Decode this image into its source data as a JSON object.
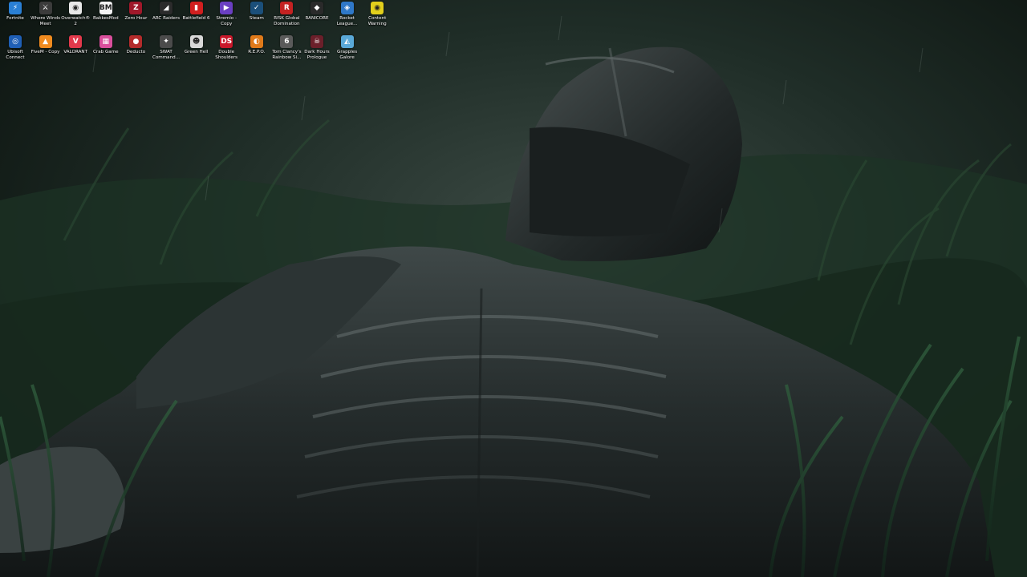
{
  "desktop": {
    "icons": [
      {
        "label": "Fortnite",
        "icon": "fortnite-icon",
        "glyph": "⚡",
        "color": "#2a7fd4"
      },
      {
        "label": "Where Winds Meet",
        "icon": "where-winds-meet-icon",
        "glyph": "⚔",
        "color": "#3b3b3b"
      },
      {
        "label": "Overwatch® 2",
        "icon": "overwatch-icon",
        "glyph": "◉",
        "color": "#e8e8e8"
      },
      {
        "label": "BakkesMod",
        "icon": "bakkesmod-icon",
        "glyph": "BM",
        "color": "#f2f2f2"
      },
      {
        "label": "Zero Hour",
        "icon": "zero-hour-icon",
        "glyph": "Z",
        "color": "#a0182a"
      },
      {
        "label": "ARC Raiders",
        "icon": "arc-raiders-icon",
        "glyph": "◢",
        "color": "#2b2b2b"
      },
      {
        "label": "Battlefield 6",
        "icon": "battlefield-icon",
        "glyph": "▮",
        "color": "#d11f1f"
      },
      {
        "label": "Stremio - Copy",
        "icon": "stremio-icon",
        "glyph": "▶",
        "color": "#6a3fc2"
      },
      {
        "label": "Steam",
        "icon": "steam-icon",
        "glyph": "✓",
        "color": "#1b4f7a"
      },
      {
        "label": "RISK Global Domination",
        "icon": "risk-icon",
        "glyph": "R",
        "color": "#c42222"
      },
      {
        "label": "RANICORE",
        "icon": "ranicore-icon",
        "glyph": "◆",
        "color": "#2a2a2a"
      },
      {
        "label": "Rocket League...",
        "icon": "rocket-league-icon",
        "glyph": "◈",
        "color": "#2f78c8"
      },
      {
        "label": "Content Warning",
        "icon": "content-warning-icon",
        "glyph": "◉",
        "color": "#e2cf1c"
      },
      {
        "label": "Ubisoft Connect",
        "icon": "ubisoft-connect-icon",
        "glyph": "◎",
        "color": "#1f5fb5"
      },
      {
        "label": "FiveM - Copy",
        "icon": "fivem-icon",
        "glyph": "▲",
        "color": "#f08b1f"
      },
      {
        "label": "VALORANT",
        "icon": "valorant-icon",
        "glyph": "V",
        "color": "#e2394b"
      },
      {
        "label": "Crab Game",
        "icon": "crab-game-icon",
        "glyph": "▦",
        "color": "#d94f9c"
      },
      {
        "label": "Deducto",
        "icon": "deducto-icon",
        "glyph": "●",
        "color": "#b32b2b"
      },
      {
        "label": "SWAT Command...",
        "icon": "swat-command-icon",
        "glyph": "✦",
        "color": "#4b4b4b"
      },
      {
        "label": "Green Hell",
        "icon": "green-hell-icon",
        "glyph": "☻",
        "color": "#d8d8d8"
      },
      {
        "label": "Double Shoulders",
        "icon": "double-shoulders-icon",
        "glyph": "DS",
        "color": "#c8182a"
      },
      {
        "label": "R.E.P.O.",
        "icon": "repo-icon",
        "glyph": "◐",
        "color": "#e07a1a"
      },
      {
        "label": "Tom Clancy's Rainbow Si...",
        "icon": "rainbow-six-icon",
        "glyph": "6",
        "color": "#5a5a5a"
      },
      {
        "label": "Dark Hours Prologue",
        "icon": "dark-hours-icon",
        "glyph": "☠",
        "color": "#6b1f2a"
      },
      {
        "label": "Grapples Galore",
        "icon": "grapples-galore-icon",
        "glyph": "◭",
        "color": "#5aa9d8"
      }
    ]
  }
}
